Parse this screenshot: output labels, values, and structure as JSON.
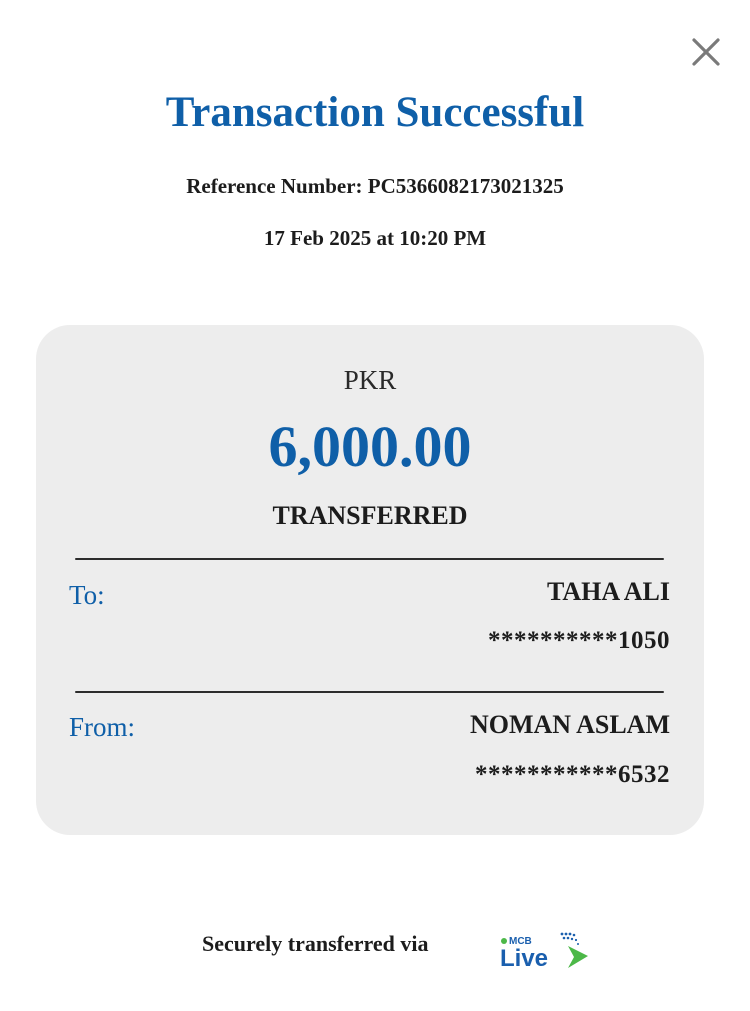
{
  "header": {
    "title": "Transaction Successful",
    "reference": "Reference Number: PC5366082173021325",
    "datetime": "17 Feb 2025 at 10:20 PM"
  },
  "amount_card": {
    "currency": "PKR",
    "amount": "6,000.00",
    "status": "TRANSFERRED"
  },
  "to": {
    "label": "To:",
    "name": "TAHA ALI",
    "account": "**********1050"
  },
  "from": {
    "label": "From:",
    "name": "NOMAN ASLAM",
    "account": "***********6532"
  },
  "footer": {
    "text": "Securely transferred via",
    "logo_top": "MCB",
    "logo_main": "Live"
  },
  "icons": {
    "close": "close-icon",
    "logo": "mcb-live-logo"
  },
  "colors": {
    "accent": "#0f5fa8",
    "card_bg": "#ededed",
    "logo_green": "#4cb848",
    "logo_blue": "#1a5fae"
  }
}
